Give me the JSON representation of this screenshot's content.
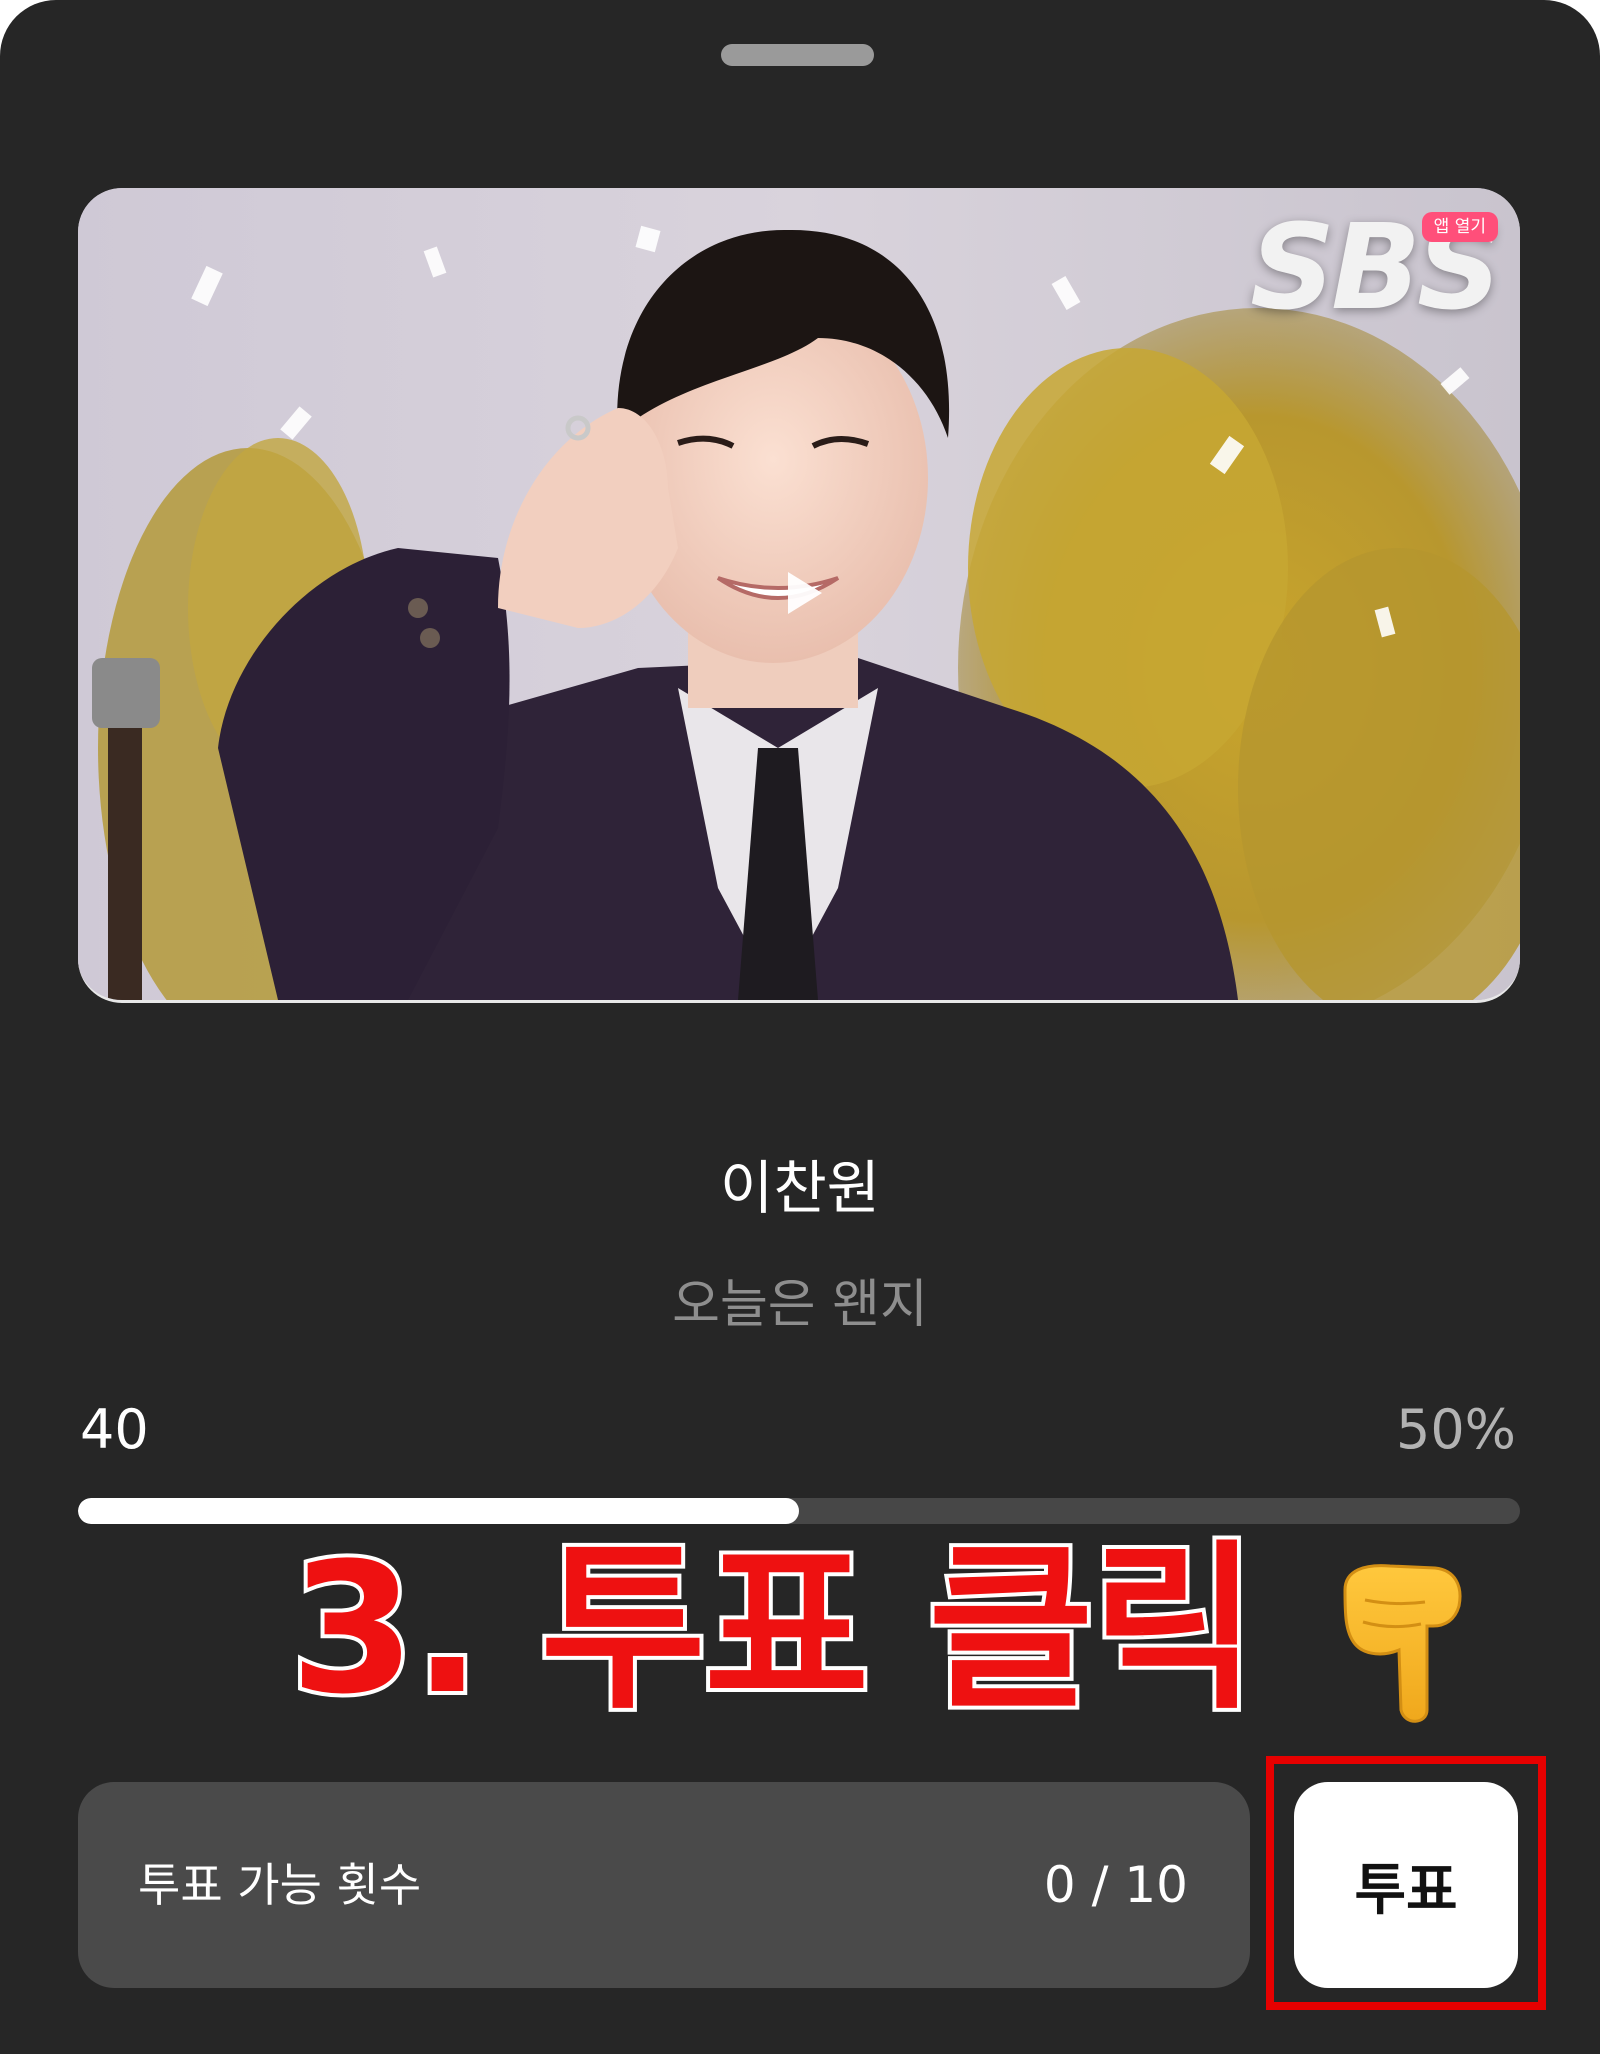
{
  "sheet": {
    "handle": "drag-handle"
  },
  "video": {
    "broadcaster_logo": "SBS",
    "app_open_badge": "앱 열기",
    "play_icon": "play-icon"
  },
  "candidate": {
    "artist_name": "이찬원",
    "song_title": "오늘은 왠지"
  },
  "vote_stats": {
    "count": "40",
    "percent_label": "50%",
    "progress_fraction": 0.5
  },
  "annotation": {
    "text": "3. 투표 클릭",
    "icon": "pointing-down-hand-icon",
    "color": "#ee1111"
  },
  "remaining_votes": {
    "label": "투표 가능 횟수",
    "value": "0 / 10"
  },
  "vote_button": {
    "label": "투표",
    "highlight_color": "#e60000"
  }
}
